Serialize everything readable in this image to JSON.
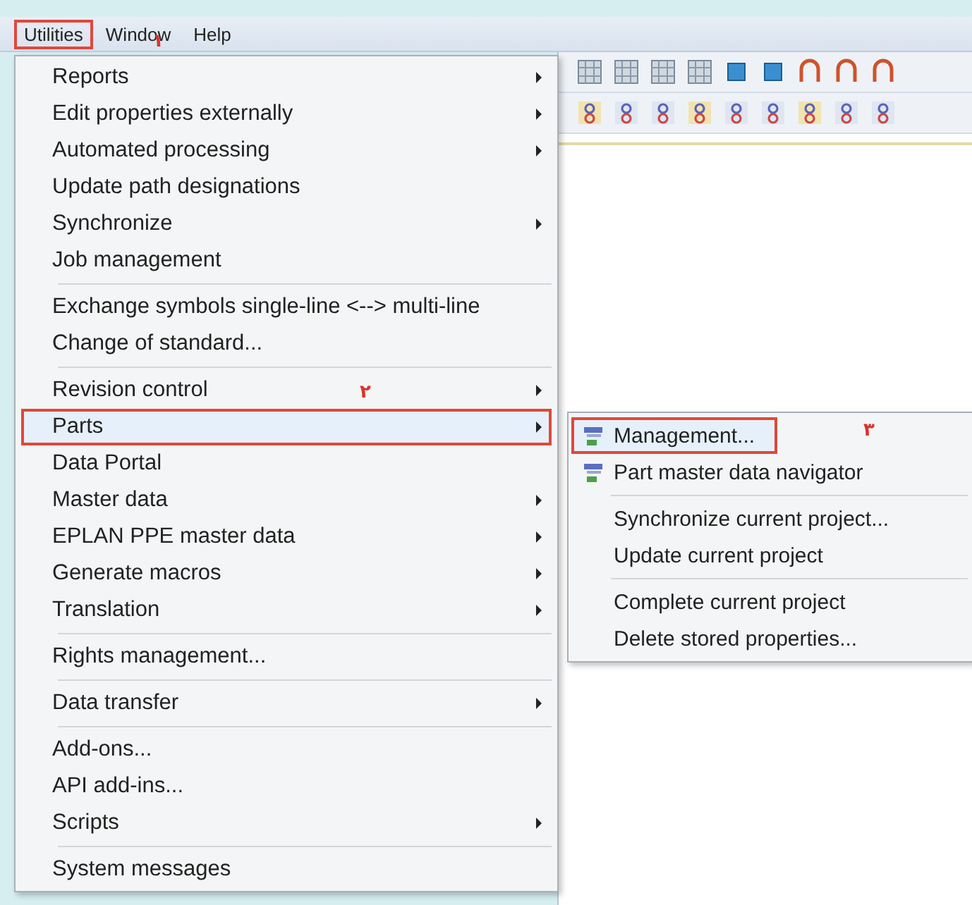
{
  "menu_bar": [
    {
      "label": "Utilities",
      "selected": true
    },
    {
      "label": "Window",
      "selected": false
    },
    {
      "label": "Help",
      "selected": false
    }
  ],
  "menu": {
    "groups": [
      [
        {
          "label": "Reports",
          "submenu": true,
          "selected": false
        },
        {
          "label": "Edit properties externally",
          "submenu": true,
          "selected": false
        },
        {
          "label": "Automated processing",
          "submenu": true,
          "selected": false
        },
        {
          "label": "Update path designations",
          "submenu": false,
          "selected": false
        },
        {
          "label": "Synchronize",
          "submenu": true,
          "selected": false
        },
        {
          "label": "Job management",
          "submenu": false,
          "selected": false
        }
      ],
      [
        {
          "label": "Exchange symbols single-line <--> multi-line",
          "submenu": false,
          "selected": false
        },
        {
          "label": "Change of standard...",
          "submenu": false,
          "selected": false
        }
      ],
      [
        {
          "label": "Revision control",
          "submenu": true,
          "selected": false
        },
        {
          "label": "Parts",
          "submenu": true,
          "selected": true
        },
        {
          "label": "Data Portal",
          "submenu": false,
          "selected": false
        },
        {
          "label": "Master data",
          "submenu": true,
          "selected": false
        },
        {
          "label": "EPLAN PPE master data",
          "submenu": true,
          "selected": false
        },
        {
          "label": "Generate macros",
          "submenu": true,
          "selected": false
        },
        {
          "label": "Translation",
          "submenu": true,
          "selected": false
        }
      ],
      [
        {
          "label": "Rights management...",
          "submenu": false,
          "selected": false
        }
      ],
      [
        {
          "label": "Data transfer",
          "submenu": true,
          "selected": false
        }
      ],
      [
        {
          "label": "Add-ons...",
          "submenu": false,
          "selected": false
        },
        {
          "label": "API add-ins...",
          "submenu": false,
          "selected": false
        },
        {
          "label": "Scripts",
          "submenu": true,
          "selected": false
        }
      ],
      [
        {
          "label": "System messages",
          "submenu": false,
          "selected": false
        }
      ]
    ]
  },
  "submenu": {
    "groups": [
      [
        {
          "label": "Management...",
          "icon": true,
          "selected": true
        },
        {
          "label": "Part master data navigator",
          "icon": true,
          "selected": false
        }
      ],
      [
        {
          "label": "Synchronize current project...",
          "icon": false,
          "selected": false
        },
        {
          "label": "Update current project",
          "icon": false,
          "selected": false
        }
      ],
      [
        {
          "label": "Complete current project",
          "icon": false,
          "selected": false
        },
        {
          "label": "Delete stored properties...",
          "icon": false,
          "selected": false
        }
      ]
    ]
  },
  "annotations": [
    {
      "label": "۱"
    },
    {
      "label": "۲"
    },
    {
      "label": "۳"
    }
  ]
}
